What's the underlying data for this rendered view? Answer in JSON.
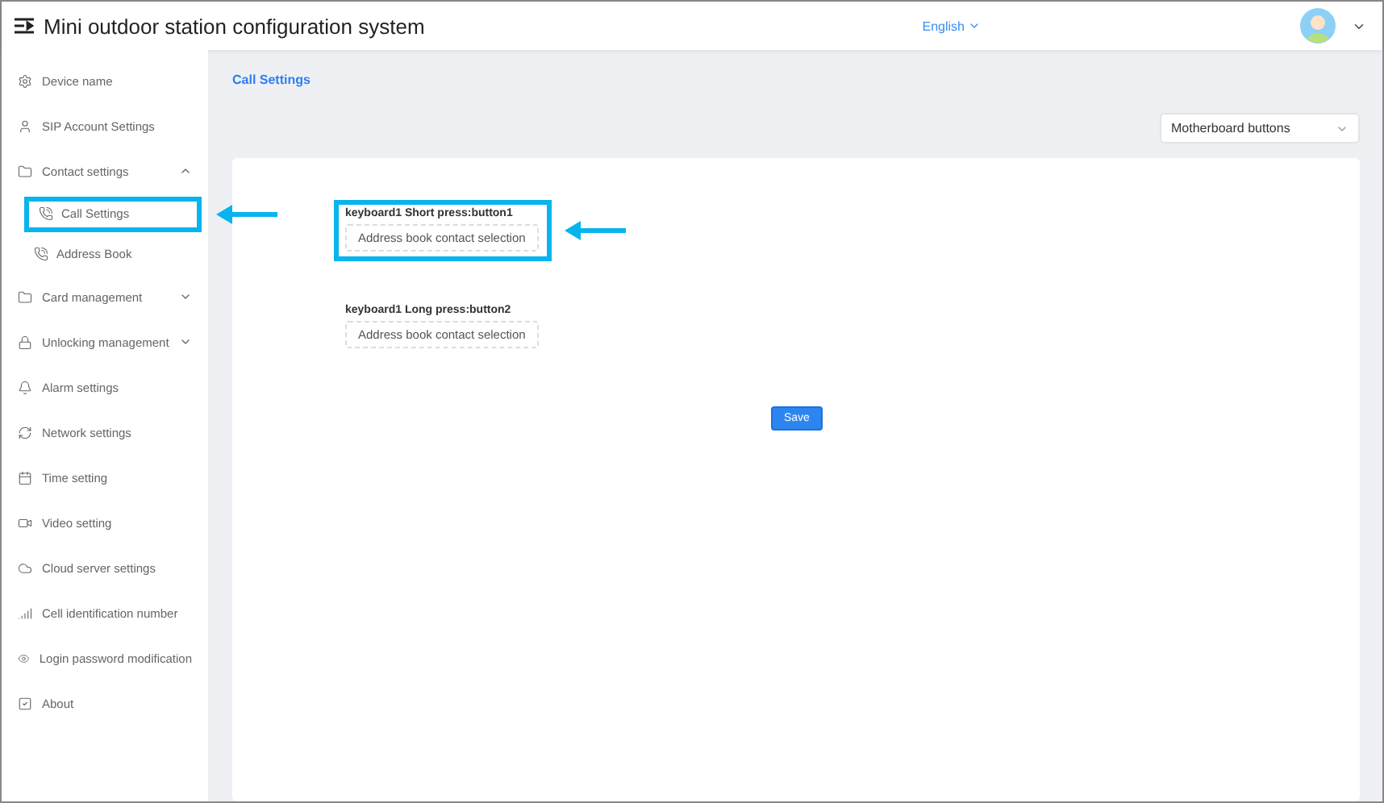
{
  "header": {
    "title": "Mini outdoor station configuration system",
    "language": "English"
  },
  "sidebar": {
    "items": [
      {
        "label": "Device name",
        "kind": "item"
      },
      {
        "label": "SIP Account Settings",
        "kind": "item"
      },
      {
        "label": "Contact settings",
        "kind": "group",
        "expanded": true,
        "children": [
          {
            "label": "Call Settings",
            "annotated": true
          },
          {
            "label": "Address Book",
            "annotated": false
          }
        ]
      },
      {
        "label": "Card management",
        "kind": "group",
        "expanded": false
      },
      {
        "label": "Unlocking management",
        "kind": "group",
        "expanded": false
      },
      {
        "label": "Alarm settings",
        "kind": "item"
      },
      {
        "label": "Network settings",
        "kind": "item"
      },
      {
        "label": "Time setting",
        "kind": "item"
      },
      {
        "label": "Video setting",
        "kind": "item"
      },
      {
        "label": "Cloud server settings",
        "kind": "item"
      },
      {
        "label": "Cell identification number",
        "kind": "item"
      },
      {
        "label": "Login password modification",
        "kind": "item"
      },
      {
        "label": "About",
        "kind": "item"
      }
    ]
  },
  "page": {
    "title": "Call Settings",
    "board_select": "Motherboard buttons",
    "fields": [
      {
        "label": "keyboard1 Short press:button1",
        "value": "Address book contact selection",
        "annotated": true
      },
      {
        "label": "keyboard1 Long press:button2",
        "value": "Address book contact selection",
        "annotated": false
      }
    ],
    "save_button": "Save"
  }
}
